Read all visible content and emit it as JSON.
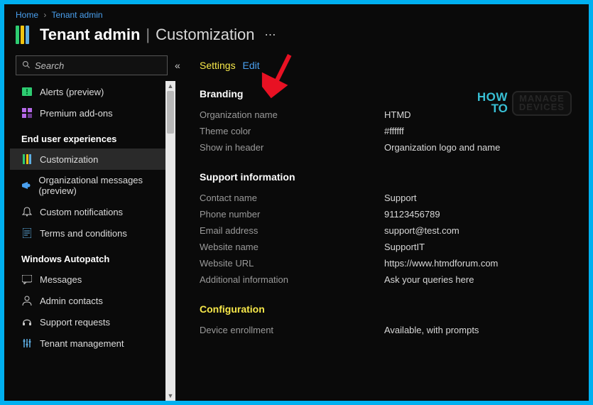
{
  "breadcrumb": {
    "home": "Home",
    "tenant": "Tenant admin"
  },
  "page": {
    "title_bold": "Tenant admin",
    "title_light": "Customization"
  },
  "search": {
    "placeholder": "Search"
  },
  "sidebar": {
    "topItems": [
      {
        "label": "Alerts (preview)"
      },
      {
        "label": "Premium add-ons"
      }
    ],
    "sections": [
      {
        "title": "End user experiences",
        "items": [
          {
            "label": "Customization",
            "active": true
          },
          {
            "label": "Organizational messages (preview)"
          },
          {
            "label": "Custom notifications"
          },
          {
            "label": "Terms and conditions"
          }
        ]
      },
      {
        "title": "Windows Autopatch",
        "items": [
          {
            "label": "Messages"
          },
          {
            "label": "Admin contacts"
          },
          {
            "label": "Support requests"
          },
          {
            "label": "Tenant management"
          }
        ]
      }
    ]
  },
  "settings": {
    "label": "Settings",
    "edit": "Edit"
  },
  "branding": {
    "title": "Branding",
    "rows": {
      "orgName": {
        "k": "Organization name",
        "v": "HTMD"
      },
      "themeColor": {
        "k": "Theme color",
        "v": "#ffffff"
      },
      "showInHeader": {
        "k": "Show in header",
        "v": "Organization logo and name"
      }
    }
  },
  "support": {
    "title": "Support information",
    "rows": {
      "contact": {
        "k": "Contact name",
        "v": "Support"
      },
      "phone": {
        "k": "Phone number",
        "v": "91123456789"
      },
      "email": {
        "k": "Email address",
        "v": "support@test.com"
      },
      "siteName": {
        "k": "Website name",
        "v": "SupportIT"
      },
      "siteUrl": {
        "k": "Website URL",
        "v": "https://www.htmdforum.com"
      },
      "info": {
        "k": "Additional information",
        "v": "Ask your queries here"
      }
    }
  },
  "config": {
    "title": "Configuration",
    "rows": {
      "enroll": {
        "k": "Device enrollment",
        "v": "Available, with prompts"
      }
    }
  },
  "watermark": {
    "l1": "HOW",
    "l2": "TO",
    "r1": "MANAGE",
    "r2": "DEVICES"
  }
}
